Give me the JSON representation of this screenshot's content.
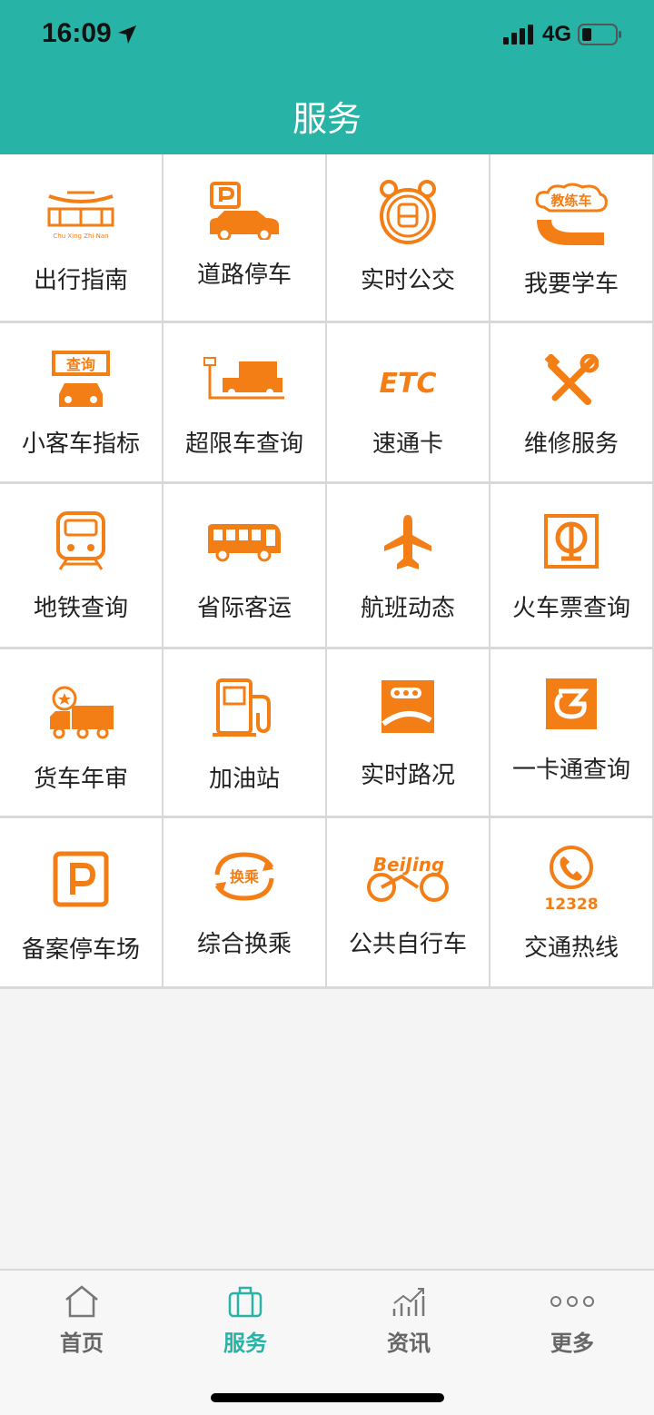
{
  "status": {
    "time": "16:09",
    "network": "4G"
  },
  "header": {
    "title": "服务"
  },
  "services": [
    {
      "label": "出行指南",
      "icon": "chuxing-logo-icon",
      "logo_text": "Chu Xing Zhi Nan"
    },
    {
      "label": "道路停车",
      "icon": "road-parking-icon"
    },
    {
      "label": "实时公交",
      "icon": "bus-clock-icon"
    },
    {
      "label": "我要学车",
      "icon": "driving-school-icon",
      "badge": "教练车"
    },
    {
      "label": "小客车指标",
      "icon": "car-quota-icon",
      "badge": "查询"
    },
    {
      "label": "超限车查询",
      "icon": "overload-truck-icon"
    },
    {
      "label": "速通卡",
      "icon": "etc-icon",
      "badge": "ETC"
    },
    {
      "label": "维修服务",
      "icon": "repair-tools-icon"
    },
    {
      "label": "地铁查询",
      "icon": "subway-icon"
    },
    {
      "label": "省际客运",
      "icon": "coach-bus-icon"
    },
    {
      "label": "航班动态",
      "icon": "airplane-icon"
    },
    {
      "label": "火车票查询",
      "icon": "railway-logo-icon"
    },
    {
      "label": "货车年审",
      "icon": "truck-inspection-icon"
    },
    {
      "label": "加油站",
      "icon": "gas-station-icon"
    },
    {
      "label": "实时路况",
      "icon": "traffic-road-icon"
    },
    {
      "label": "一卡通查询",
      "icon": "card-icon"
    },
    {
      "label": "备案停车场",
      "icon": "parking-lot-icon"
    },
    {
      "label": "综合换乘",
      "icon": "transfer-icon",
      "badge": "换乘"
    },
    {
      "label": "公共自行车",
      "icon": "bicycle-icon",
      "badge": "BeiJing"
    },
    {
      "label": "交通热线",
      "icon": "hotline-icon",
      "badge": "12328"
    }
  ],
  "tabs": [
    {
      "label": "首页",
      "icon": "home-icon"
    },
    {
      "label": "服务",
      "icon": "briefcase-icon",
      "active": true
    },
    {
      "label": "资讯",
      "icon": "chart-icon"
    },
    {
      "label": "更多",
      "icon": "more-icon"
    }
  ],
  "colors": {
    "accent": "#27b3a6",
    "icon_orange": "#f47e16"
  }
}
